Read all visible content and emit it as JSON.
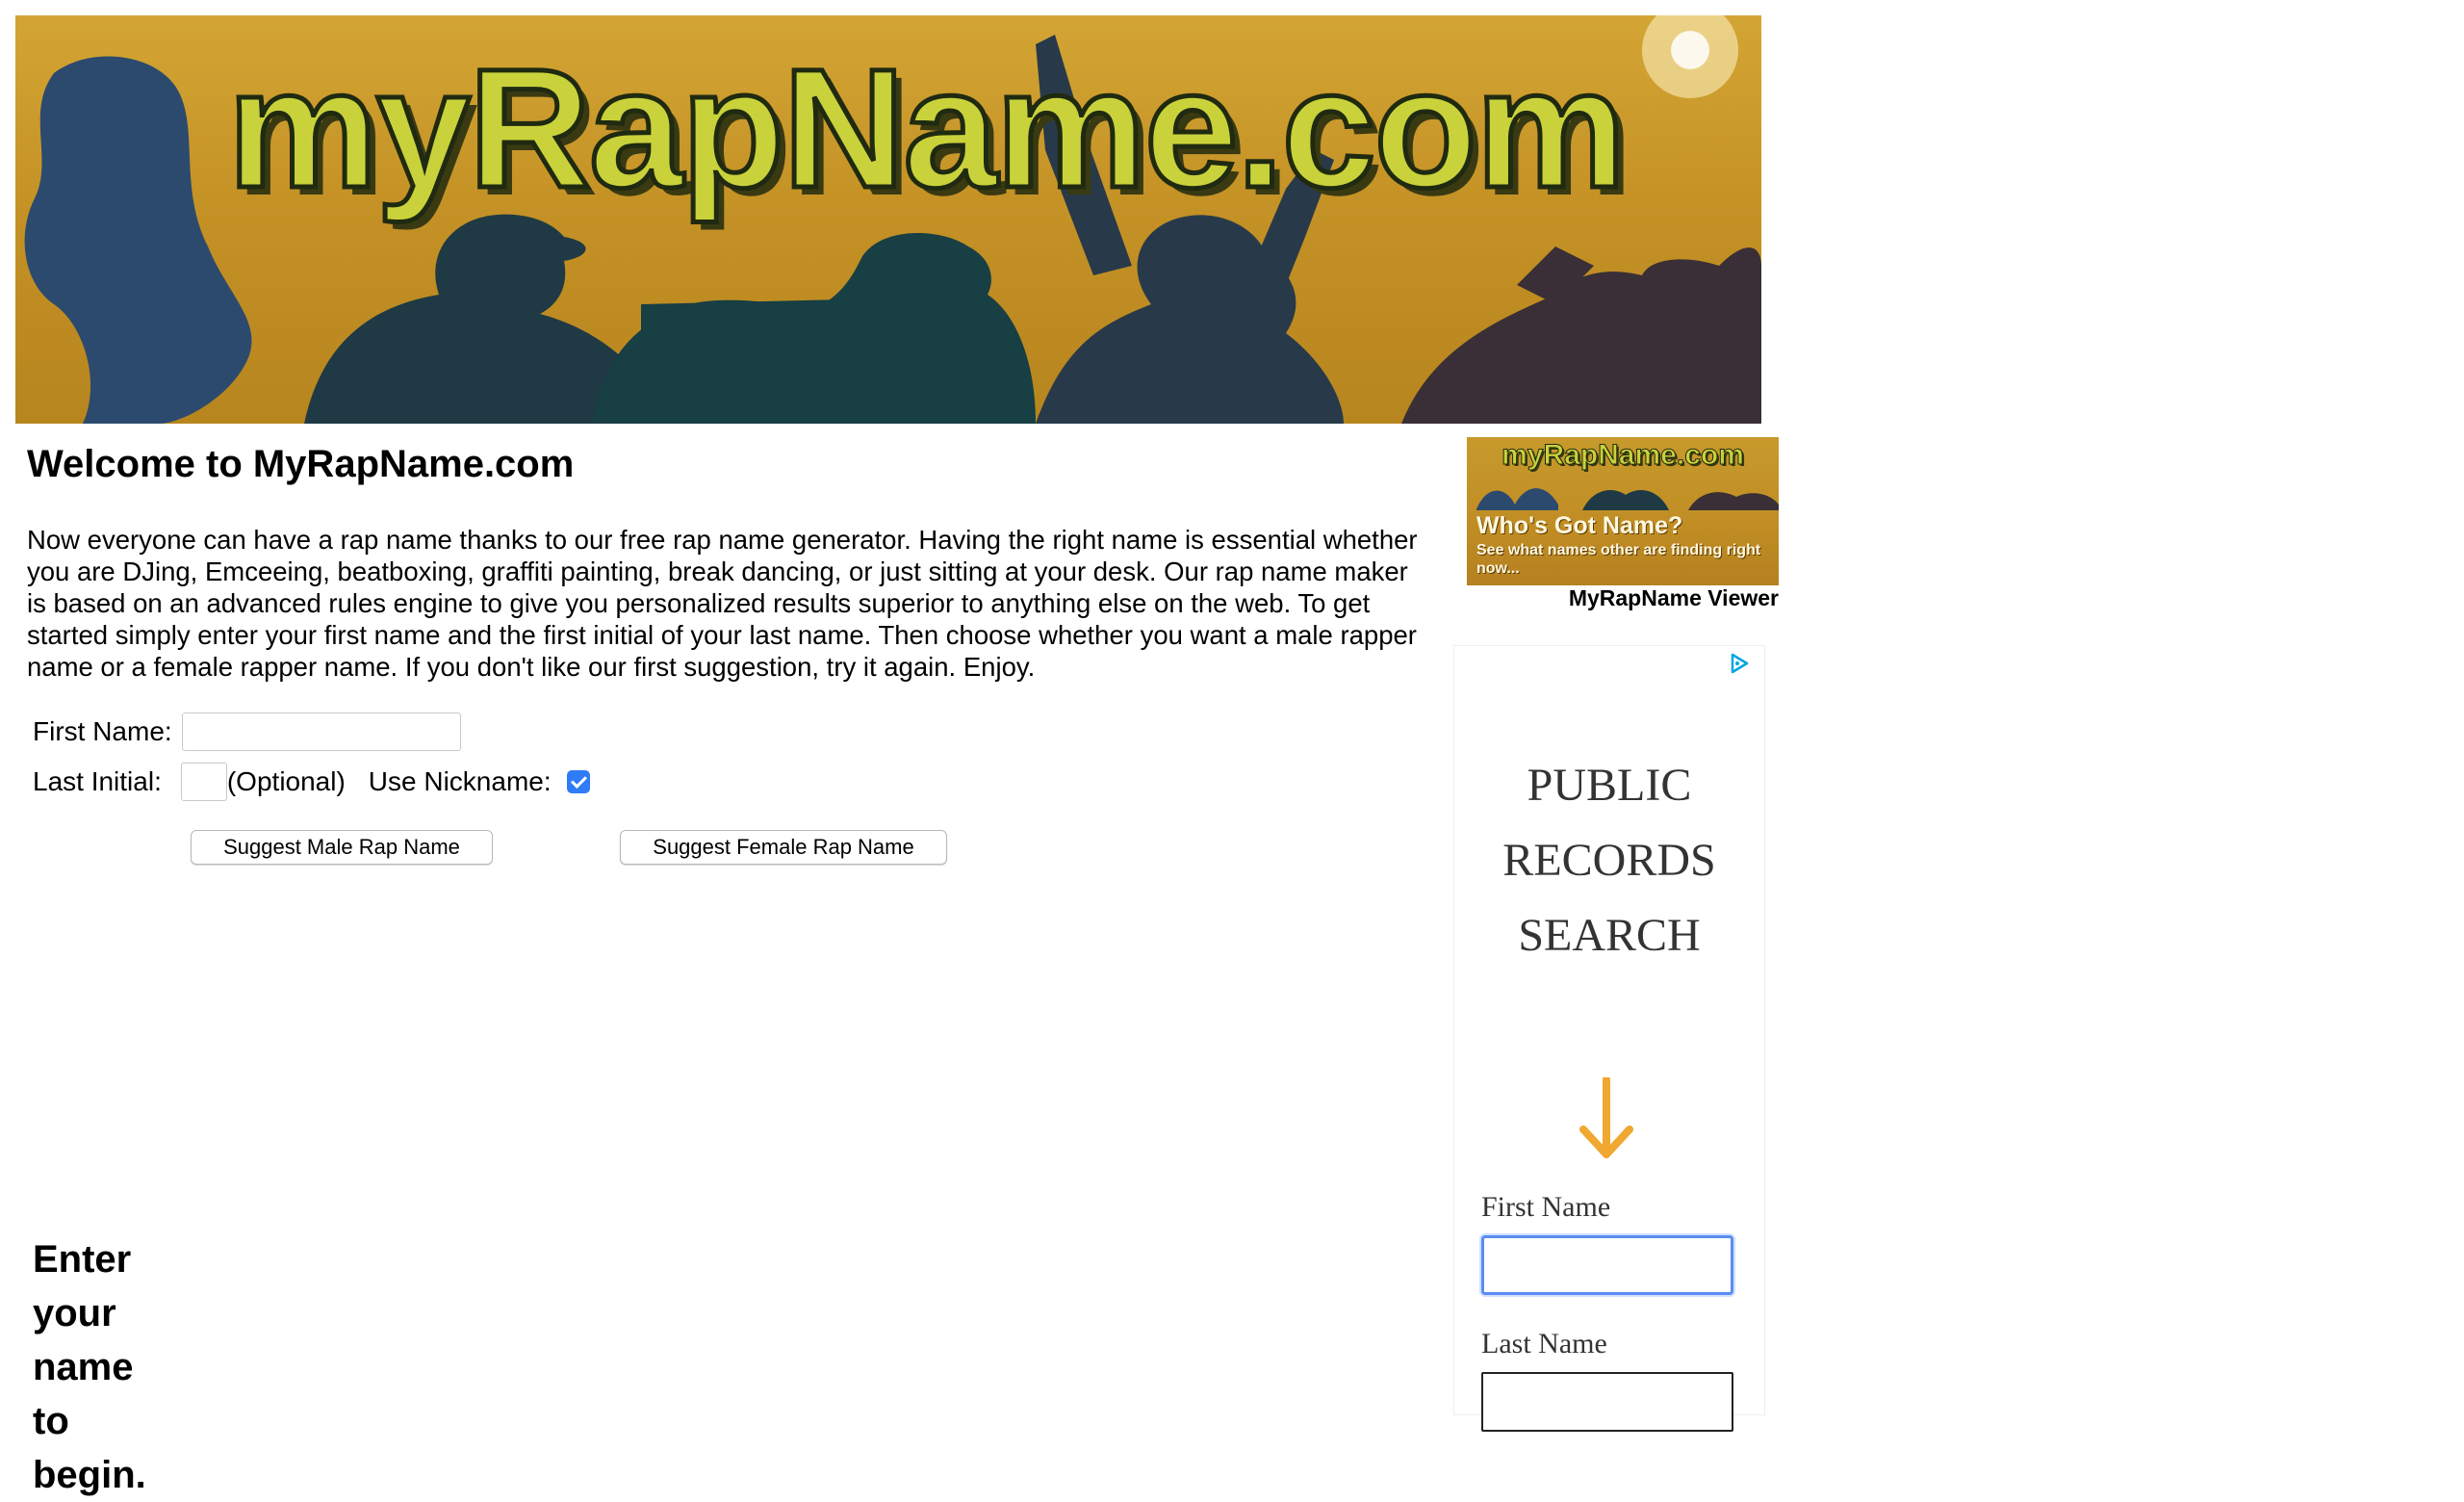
{
  "banner": {
    "title": "myRapName.com",
    "accent_color": "#c9d23a"
  },
  "main": {
    "heading": "Welcome to MyRapName.com",
    "intro": "Now everyone can have a rap name thanks to our free rap name generator. Having the right name is essential whether you are DJing, Emceeing, beatboxing, graffiti painting, break dancing, or just sitting at your desk. Our rap name maker is based on an advanced rules engine to give you personalized results superior to anything else on the web. To get started simply enter your first name and the first initial of your last name. Then choose whether you want a male rapper name or a female rapper name. If you don't like our first suggestion, try it again. Enjoy.",
    "form": {
      "first_name_label": "First Name:",
      "first_name_value": "",
      "last_initial_label": "Last Initial:",
      "last_initial_value": "",
      "optional_text": "(Optional)",
      "nickname_label": "Use Nickname:",
      "nickname_checked": true,
      "male_button": "Suggest Male Rap Name",
      "female_button": "Suggest Female Rap Name"
    },
    "prompt": "Enter your name to begin."
  },
  "viewer": {
    "thumb_title": "myRapName.com",
    "thumb_headline": "Who's Got Name?",
    "thumb_subtext": "See what names other are finding right now...",
    "caption": "MyRapName Viewer"
  },
  "ad": {
    "headline_line1": "PUBLIC",
    "headline_line2": "RECORDS",
    "headline_line3": "SEARCH",
    "first_name_label": "First Name",
    "last_name_label": "Last Name",
    "arrow_color": "#f0a830",
    "choices_color": "#00a6e0"
  }
}
